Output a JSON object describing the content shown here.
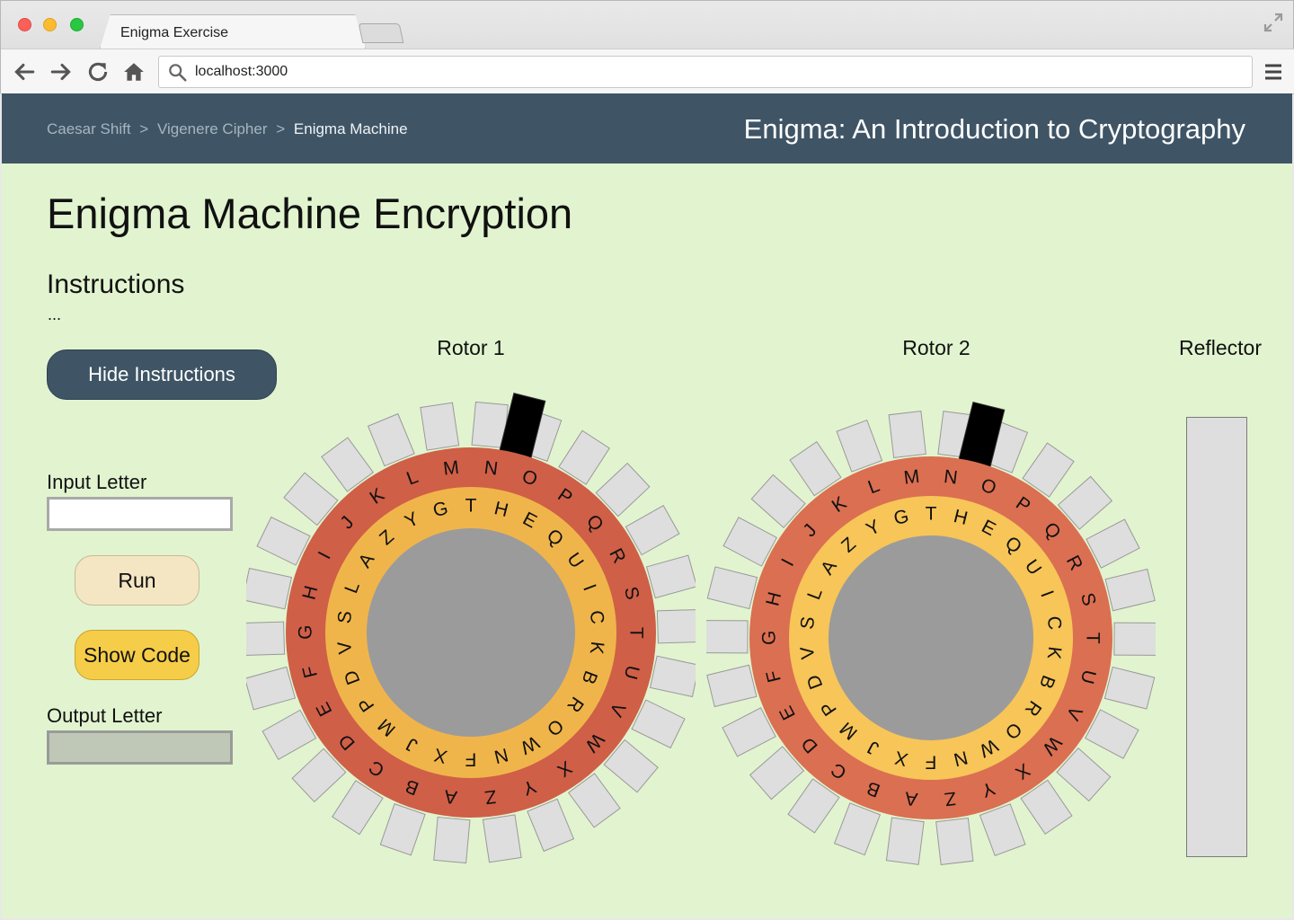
{
  "browser": {
    "tab_title": "Enigma Exercise",
    "url": "localhost:3000"
  },
  "header": {
    "breadcrumbs": [
      "Caesar Shift",
      "Vigenere Cipher",
      "Enigma Machine"
    ],
    "separator": ">",
    "site_title": "Enigma: An Introduction to Cryptography"
  },
  "main": {
    "title": "Enigma Machine Encryption",
    "instructions_heading": "Instructions",
    "instructions_text": "...",
    "hide_button": "Hide Instructions",
    "input_label": "Input Letter",
    "input_value": "",
    "run_button": "Run",
    "show_code_button": "Show Code",
    "output_label": "Output Letter",
    "output_value": ""
  },
  "rotors": [
    {
      "label": "Rotor 1",
      "outer_letters": "ABCDEFGHIJKLMNOPQRSTUVWXYZ",
      "inner_letters": "THEQUICKBROWNFXJMPDVSLAZYG",
      "outer_color": "#cf5f47",
      "inner_color": "#f0b54a"
    },
    {
      "label": "Rotor 2",
      "outer_letters": "ABCDEFGHIJKLMNOPQRSTUVWXYZ",
      "inner_letters": "THEQUICKBROWNFXJMPDVSLAZYG",
      "outer_color": "#db6f51",
      "inner_color": "#f7c558"
    }
  ],
  "reflector": {
    "label": "Reflector"
  }
}
